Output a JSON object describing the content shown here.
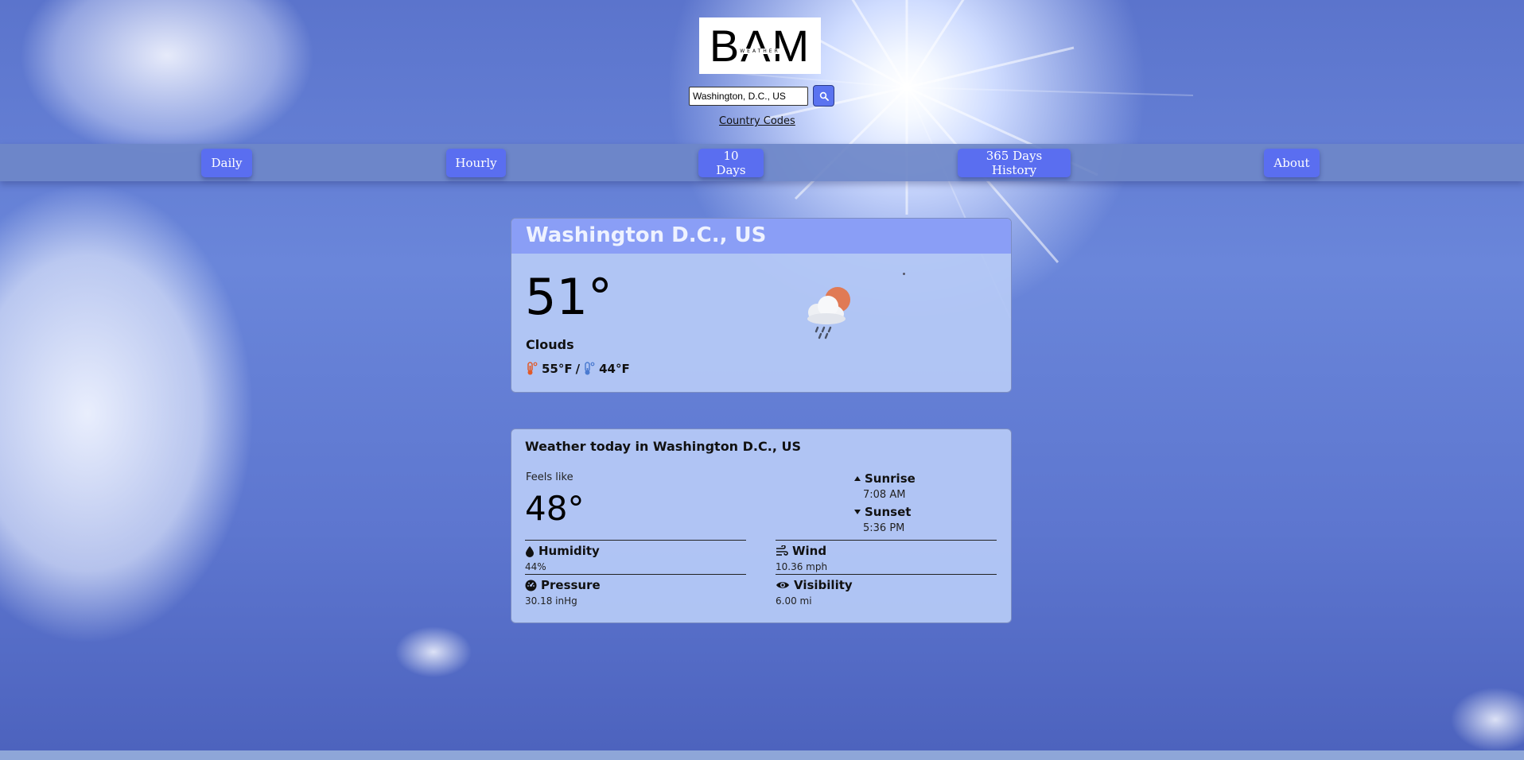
{
  "header": {
    "logo_text": "BAM",
    "logo_subtext": "WEATHER",
    "search_value": "Washington, D.C., US",
    "search_icon": "search-icon",
    "country_codes_label": "Country Codes"
  },
  "nav": {
    "daily": "Daily",
    "hourly": "Hourly",
    "ten_days": "10 Days",
    "history": "365 Days History",
    "about": "About"
  },
  "current": {
    "location": "Washington D.C., US",
    "temperature": "51°",
    "condition": "Clouds",
    "high": "55°F",
    "separator": "/",
    "low": "44°F",
    "icon": "cloud-sun-rain-icon"
  },
  "today": {
    "title": "Weather today in Washington D.C., US",
    "feels_like_label": "Feels like",
    "feels_like_value": "48°",
    "sunrise_label": "Sunrise",
    "sunrise_time": "7:08 AM",
    "sunset_label": "Sunset",
    "sunset_time": "5:36 PM",
    "humidity_label": "Humidity",
    "humidity_value": "44%",
    "wind_label": "Wind",
    "wind_value": "10.36 mph",
    "pressure_label": "Pressure",
    "pressure_value": "30.18 inHg",
    "visibility_label": "Visibility",
    "visibility_value": "6.00 mi"
  },
  "colors": {
    "accent": "#5a6ef0",
    "card_header": "#8a9ef6",
    "card_bg": "#b4c8f5",
    "high_temp": "#e05a2a",
    "low_temp": "#4a7ad0"
  }
}
